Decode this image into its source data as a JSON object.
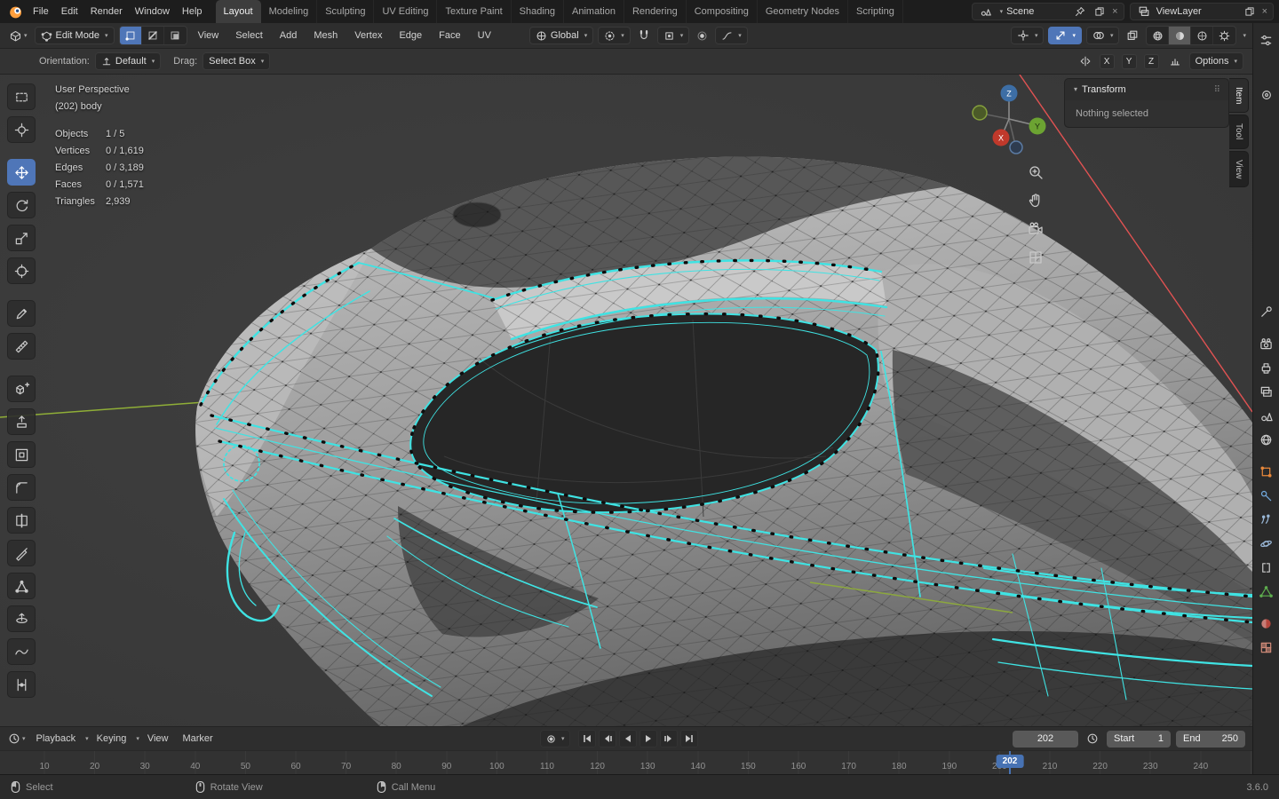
{
  "topbar": {
    "menus": [
      "File",
      "Edit",
      "Render",
      "Window",
      "Help"
    ],
    "workspaces": [
      "Layout",
      "Modeling",
      "Sculpting",
      "UV Editing",
      "Texture Paint",
      "Shading",
      "Animation",
      "Rendering",
      "Compositing",
      "Geometry Nodes",
      "Scripting"
    ],
    "active_workspace": "Layout",
    "scene_name": "Scene",
    "viewlayer_name": "ViewLayer"
  },
  "viewport_header": {
    "mode": "Edit Mode",
    "menus": [
      "View",
      "Select",
      "Add",
      "Mesh",
      "Vertex",
      "Edge",
      "Face",
      "UV"
    ],
    "orientation": "Global"
  },
  "tool_settings": {
    "orientation_label": "Orientation:",
    "orientation_value": "Default",
    "drag_label": "Drag:",
    "drag_value": "Select Box",
    "mirror_x": "X",
    "mirror_y": "Y",
    "mirror_z": "Z",
    "options_label": "Options"
  },
  "viewport": {
    "perspective_label": "User Perspective",
    "object_name": "(202) body",
    "stats": [
      {
        "label": "Objects",
        "value": "1 / 5"
      },
      {
        "label": "Vertices",
        "value": "0 / 1,619"
      },
      {
        "label": "Edges",
        "value": "0 / 3,189"
      },
      {
        "label": "Faces",
        "value": "0 / 1,571"
      },
      {
        "label": "Triangles",
        "value": "2,939"
      }
    ],
    "gizmo": {
      "x": "X",
      "y": "Y",
      "z": "Z"
    },
    "npanel": {
      "title": "Transform",
      "message": "Nothing selected",
      "tabs": [
        "Item",
        "Tool",
        "View"
      ],
      "active_tab": "Item"
    }
  },
  "timeline": {
    "menus": [
      "Playback",
      "Keying",
      "View",
      "Marker"
    ],
    "current_frame": "202",
    "start_label": "Start",
    "start_value": "1",
    "end_label": "End",
    "end_value": "250",
    "ticks": [
      "10",
      "20",
      "30",
      "40",
      "50",
      "60",
      "70",
      "80",
      "90",
      "100",
      "110",
      "120",
      "130",
      "140",
      "150",
      "160",
      "170",
      "180",
      "190",
      "200",
      "210",
      "220",
      "230",
      "240"
    ]
  },
  "statusbar": {
    "select_hint": "Select",
    "rotate_hint": "Rotate View",
    "call_menu_hint": "Call Menu",
    "version": "3.6.0"
  },
  "icons": {
    "toolbar": [
      "select-box",
      "cursor",
      "move",
      "rotate",
      "scale",
      "transform",
      "annotate",
      "measure",
      "add-cube",
      "extrude-region",
      "inset-faces",
      "bevel",
      "loop-cut",
      "knife",
      "poly-build",
      "spin",
      "smooth",
      "edge-slide"
    ],
    "properties_tabs": [
      "tool",
      "render",
      "output",
      "view-layer",
      "scene",
      "world",
      "object",
      "modifiers",
      "particles",
      "physics",
      "constraints",
      "object-data",
      "material",
      "texture"
    ]
  },
  "colors": {
    "accent_blue": "#4772b3",
    "selection_cyan": "#3fe3e3",
    "object_orange": "#e8883b",
    "axis_x_red": "#c0392b",
    "axis_y_green": "#6ca332",
    "axis_z_blue": "#3d6ea5"
  }
}
